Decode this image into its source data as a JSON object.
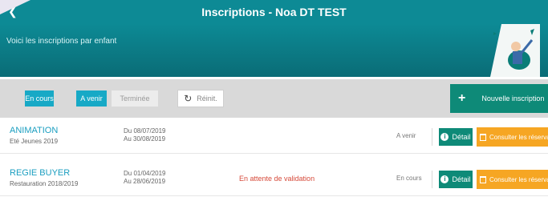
{
  "header": {
    "title": "Inscriptions  -  Noa DT TEST",
    "back_icon": "back-chevron-icon"
  },
  "banner": {
    "text": "Voici les inscriptions par enfant"
  },
  "filters": {
    "tabs": [
      {
        "label": "En cours",
        "active": true
      },
      {
        "label": "A venir",
        "active": true
      },
      {
        "label": "Terminée",
        "active": false
      }
    ],
    "reset_label": "Réinit."
  },
  "new_button": {
    "label": "Nouvelle inscription"
  },
  "inscriptions": [
    {
      "title": "ANIMATION",
      "subtitle": "Eté Jeunes 2019",
      "date_from": "Du 08/07/2019",
      "date_to": "Au 30/08/2019",
      "message": "",
      "state": "A venir",
      "detail_label": "Détail",
      "consult_label": "Consulter les réservations"
    },
    {
      "title": "REGIE BUYER",
      "subtitle": "Restauration 2018/2019",
      "date_from": "Du 01/04/2019",
      "date_to": "Au 28/06/2019",
      "message": "En attente de validation",
      "state": "En cours",
      "detail_label": "Détail",
      "consult_label": "Consulter les réservations"
    }
  ],
  "colors": {
    "brand_teal": "#0d8a95",
    "button_green": "#0e8a78",
    "tab_active": "#17a9c6",
    "consult_orange": "#f6a623",
    "warning_red": "#d64a3a"
  }
}
